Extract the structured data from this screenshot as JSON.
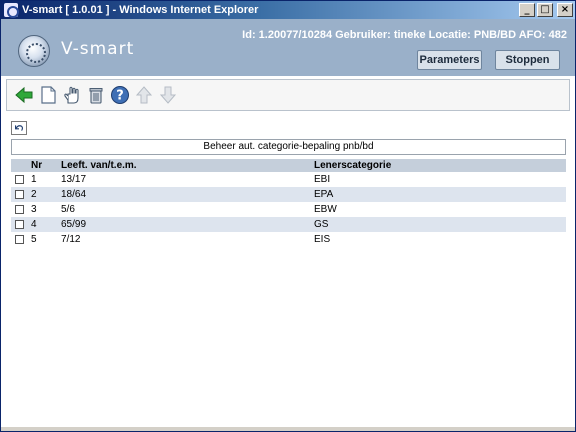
{
  "window": {
    "title": "V-smart [ 1.0.01 ] - Windows Internet Explorer",
    "minimize": "_",
    "maximize": "□",
    "close": "×"
  },
  "header": {
    "logo_text": "V-smart",
    "info": "Id: 1.20077/10284   Gebruiker: tineke   Locatie: PNB/BD   AFO: 482",
    "parameters_button": "Parameters",
    "stop_button": "Stoppen"
  },
  "toolbar": {
    "icons": [
      "back-arrow-icon",
      "new-document-icon",
      "hand-select-icon",
      "trash-icon",
      "help-icon",
      "arrow-up-icon",
      "arrow-down-icon"
    ]
  },
  "caption": "Beheer aut. categorie-bepaling pnb/bd",
  "table": {
    "headers": [
      "Nr",
      "Leeft. van/t.e.m.",
      "Lenerscategorie"
    ],
    "rows": [
      {
        "nr": "1",
        "range": "13/17",
        "category": "EBI"
      },
      {
        "nr": "2",
        "range": "18/64",
        "category": "EPA"
      },
      {
        "nr": "3",
        "range": "5/6",
        "category": "EBW"
      },
      {
        "nr": "4",
        "range": "65/99",
        "category": "GS"
      },
      {
        "nr": "5",
        "range": "7/12",
        "category": "EIS"
      }
    ]
  },
  "colors": {
    "header_band": "#9ab0c9",
    "title_bar": "#0a246a",
    "row_alt": "#dde4ee",
    "table_header": "#c5cfdb"
  }
}
